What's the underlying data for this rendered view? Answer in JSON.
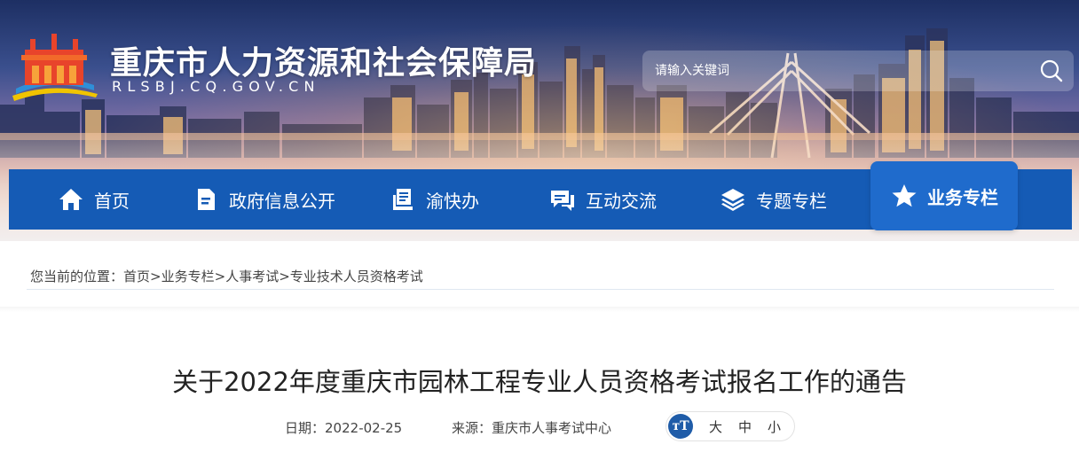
{
  "header": {
    "site_title": "重庆市人力资源和社会保障局",
    "site_domain": "RLSBJ.CQ.GOV.CN"
  },
  "search": {
    "placeholder": "请输入关键词"
  },
  "nav": {
    "items": [
      {
        "label": "首页",
        "icon": "home-icon"
      },
      {
        "label": "政府信息公开",
        "icon": "document-icon"
      },
      {
        "label": "渝快办",
        "icon": "service-desk-icon"
      },
      {
        "label": "互动交流",
        "icon": "chat-bubbles-icon"
      },
      {
        "label": "专题专栏",
        "icon": "layers-icon"
      },
      {
        "label": "业务专栏",
        "icon": "star-icon",
        "active": true
      }
    ]
  },
  "breadcrumb": {
    "prefix": "您当前的位置：",
    "items": [
      "首页",
      "业务专栏",
      "人事考试",
      "专业技术人员资格考试"
    ],
    "separator": ">"
  },
  "article": {
    "title": "关于2022年度重庆市园林工程专业人员资格考试报名工作的通告",
    "date_label": "日期：",
    "date": "2022-02-25",
    "source_label": "来源：",
    "source": "重庆市人事考试中心",
    "font_size": {
      "icon_text": "тT",
      "large": "大",
      "medium": "中",
      "small": "小"
    }
  },
  "colors": {
    "nav_bg": "#155bb5",
    "nav_active": "#1f6bcc",
    "fontsize_icon": "#1f5ca8"
  }
}
